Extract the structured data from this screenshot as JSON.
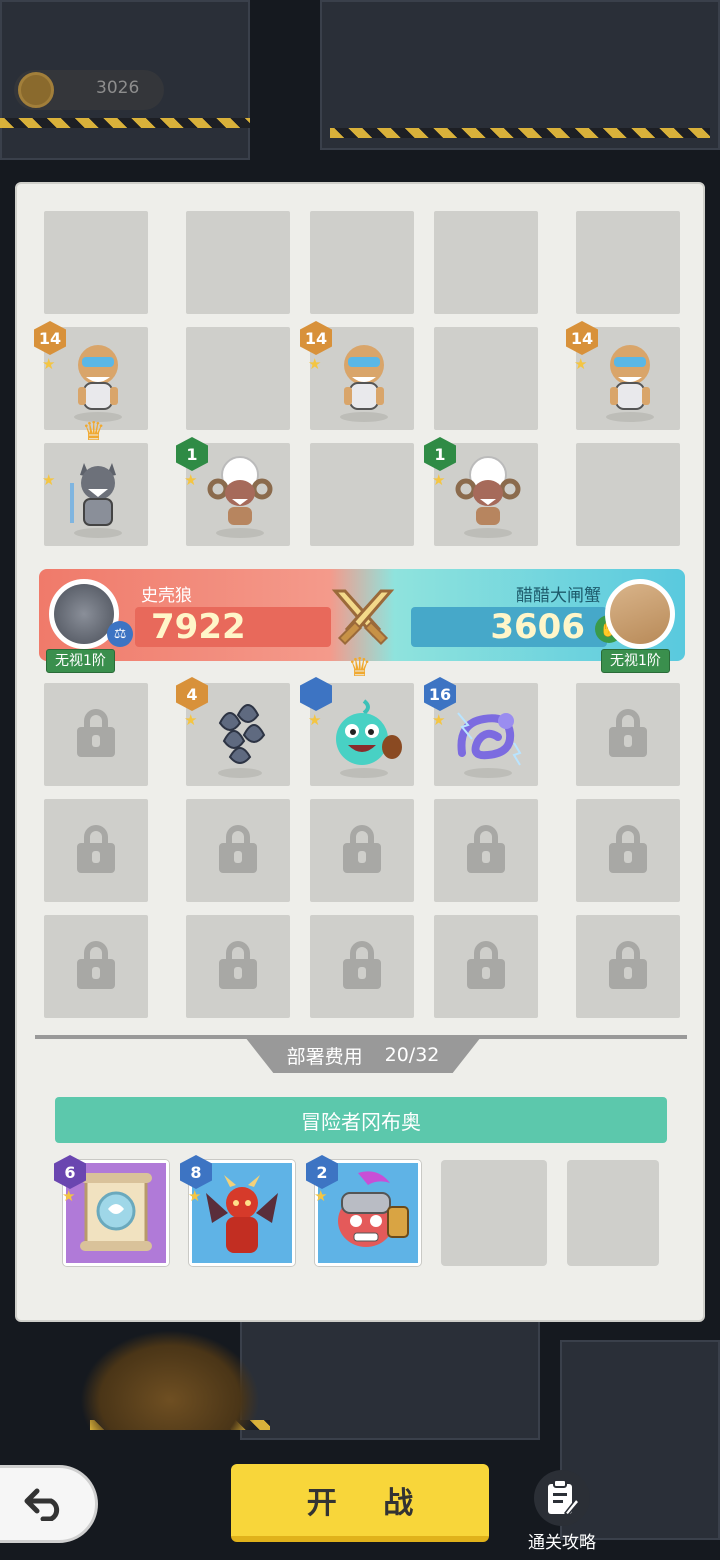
{
  "top_bar": {
    "coins": "3026"
  },
  "enemy_grid": {
    "rows": [
      [
        {
          "type": "empty"
        },
        {
          "type": "empty"
        },
        {
          "type": "empty"
        },
        {
          "type": "empty"
        },
        {
          "type": "empty"
        }
      ],
      [
        {
          "type": "unit",
          "icon": "tiger-robot-icon",
          "level": "14",
          "badge": "orange"
        },
        {
          "type": "empty"
        },
        {
          "type": "unit",
          "icon": "tiger-robot-icon",
          "level": "14",
          "badge": "orange"
        },
        {
          "type": "empty"
        },
        {
          "type": "unit",
          "icon": "tiger-robot-icon",
          "level": "14",
          "badge": "orange"
        }
      ],
      [
        {
          "type": "unit",
          "icon": "werewolf-icon",
          "level": "",
          "badge": "none",
          "crown": true
        },
        {
          "type": "unit",
          "icon": "sheep-monster-icon",
          "level": "1",
          "badge": "green"
        },
        {
          "type": "empty"
        },
        {
          "type": "unit",
          "icon": "sheep-monster-icon",
          "level": "1",
          "badge": "green"
        },
        {
          "type": "empty"
        }
      ]
    ]
  },
  "versus": {
    "left": {
      "name": "史壳狼",
      "score": "7922",
      "tag": "无视1阶"
    },
    "right": {
      "name": "醋醋大闸蟹",
      "score": "3606",
      "tag": "无视1阶"
    }
  },
  "player_grid": {
    "rows": [
      [
        {
          "type": "locked"
        },
        {
          "type": "unit",
          "icon": "scale-armor-icon",
          "level": "4",
          "badge": "orange"
        },
        {
          "type": "unit",
          "icon": "fish-hero-icon",
          "level": "",
          "badge": "blue",
          "crown": true
        },
        {
          "type": "unit",
          "icon": "thunder-dragon-icon",
          "level": "16",
          "badge": "blue"
        },
        {
          "type": "locked"
        }
      ],
      [
        {
          "type": "locked"
        },
        {
          "type": "locked"
        },
        {
          "type": "locked"
        },
        {
          "type": "locked"
        },
        {
          "type": "locked"
        }
      ],
      [
        {
          "type": "locked"
        },
        {
          "type": "locked"
        },
        {
          "type": "locked"
        },
        {
          "type": "locked"
        },
        {
          "type": "locked"
        }
      ]
    ]
  },
  "deploy": {
    "label": "部署费用",
    "value": "20/32"
  },
  "hero": {
    "name": "冒险者冈布奥"
  },
  "cards": [
    {
      "icon": "scroll-icon",
      "level": "6",
      "badge": "purple"
    },
    {
      "icon": "demon-icon",
      "level": "8",
      "badge": "blue"
    },
    {
      "icon": "knight-icon",
      "level": "2",
      "badge": "blue"
    },
    {
      "icon": "",
      "level": "",
      "badge": "none"
    },
    {
      "icon": "",
      "level": "",
      "badge": "none"
    }
  ],
  "controls": {
    "start_label": "开 战",
    "guide_label": "通关攻略"
  },
  "colors": {
    "panel_bg": "#eeeeea",
    "slot_bg": "#cfcfcb",
    "start_button": "#f8d63a",
    "hero_bar": "#5cc8ac",
    "left_side": "#f07a6a",
    "right_side": "#59c9de"
  }
}
